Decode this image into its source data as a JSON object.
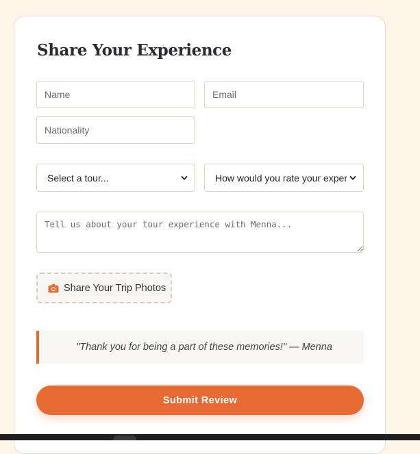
{
  "form": {
    "title": "Share Your Experience",
    "name_placeholder": "Name",
    "email_placeholder": "Email",
    "nationality_placeholder": "Nationality",
    "tour_select": "Select a tour...",
    "rating_select": "How would you rate your exper",
    "message_placeholder": "Tell us about your tour experience with Menna...",
    "upload_label": "Share Your Trip Photos",
    "quote": "\"Thank you for being a part of these memories!\" — Menna",
    "submit_label": "Submit Review"
  },
  "icons": {
    "upload": "camera-icon",
    "select": "chevron-down-icon"
  },
  "colors": {
    "accent": "#e86a33",
    "background": "#fdf5e8",
    "card": "#ffffff",
    "heading": "#2b2b33"
  }
}
